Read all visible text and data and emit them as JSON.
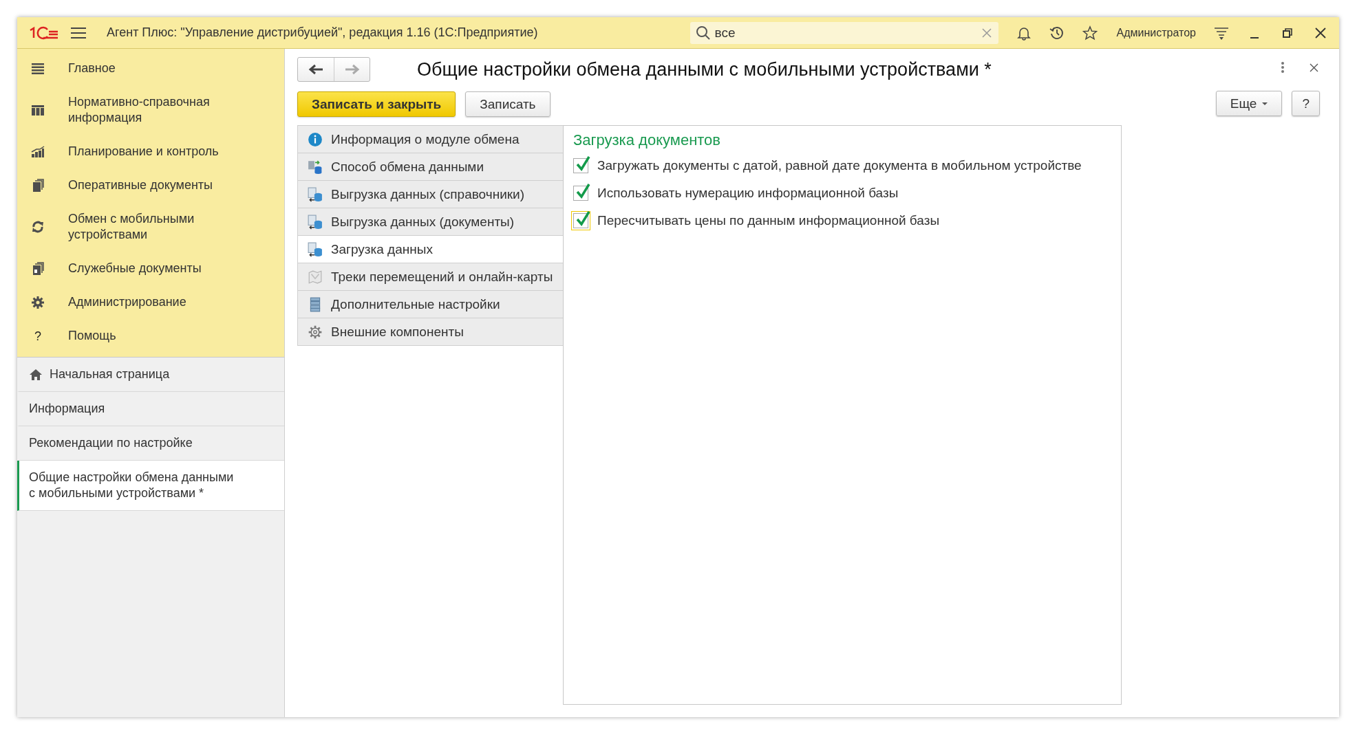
{
  "window": {
    "title": "Агент Плюс: \"Управление дистрибуцией\", редакция 1.16  (1С:Предприятие)",
    "search": {
      "value": "все"
    },
    "user": "Администратор"
  },
  "sections": [
    {
      "label": "Главное",
      "kind": "list"
    },
    {
      "label": "Нормативно-справочная информация",
      "kind": "books"
    },
    {
      "label": "Планирование и контроль",
      "kind": "bars"
    },
    {
      "label": "Оперативные документы",
      "kind": "docs"
    },
    {
      "label": "Обмен с мобильными устройствами",
      "kind": "sync"
    },
    {
      "label": "Служебные документы",
      "kind": "docs2"
    },
    {
      "label": "Администрирование",
      "kind": "gear"
    },
    {
      "label": "Помощь",
      "kind": "help",
      "glyph": "?"
    }
  ],
  "open_windows": [
    {
      "label": "Начальная страница",
      "kind": "home",
      "selected": false
    },
    {
      "label": "Информация",
      "kind": "page",
      "selected": false
    },
    {
      "label": "Рекомендации по настройке",
      "kind": "page",
      "selected": false
    },
    {
      "label": "Общие настройки обмена данными с мобильными устройствами *",
      "kind": "page",
      "selected": true
    }
  ],
  "form": {
    "title": "Общие настройки обмена данными с мобильными устройствами *",
    "buttons": [
      {
        "label": "Записать и закрыть",
        "kind": "primary"
      },
      {
        "label": "Записать",
        "kind": "normal"
      }
    ],
    "more": "Еще",
    "help": "?",
    "nav": [
      {
        "label": "Информация о модуле обмена",
        "kind": "info",
        "selected": false
      },
      {
        "label": "Способ обмена данными",
        "kind": "exchange",
        "selected": false
      },
      {
        "label": "Выгрузка данных (справочники)",
        "kind": "upload",
        "selected": false
      },
      {
        "label": "Выгрузка данных (документы)",
        "kind": "upload",
        "selected": false
      },
      {
        "label": "Загрузка данных",
        "kind": "upload",
        "selected": true
      },
      {
        "label": "Треки перемещений и онлайн-карты",
        "kind": "map",
        "selected": false
      },
      {
        "label": "Дополнительные настройки",
        "kind": "stack",
        "selected": false
      },
      {
        "label": "Внешние компоненты",
        "kind": "gear",
        "selected": false
      }
    ],
    "group_title": "Загрузка документов",
    "options": [
      {
        "label": "Загружать документы с датой, равной дате документа в мобильном устройстве",
        "checked": true,
        "focused": false
      },
      {
        "label": "Использовать нумерацию информационной базы",
        "checked": true,
        "focused": false
      },
      {
        "label": "Пересчитывать цены по данным информационной базы",
        "checked": true,
        "focused": true
      }
    ]
  }
}
